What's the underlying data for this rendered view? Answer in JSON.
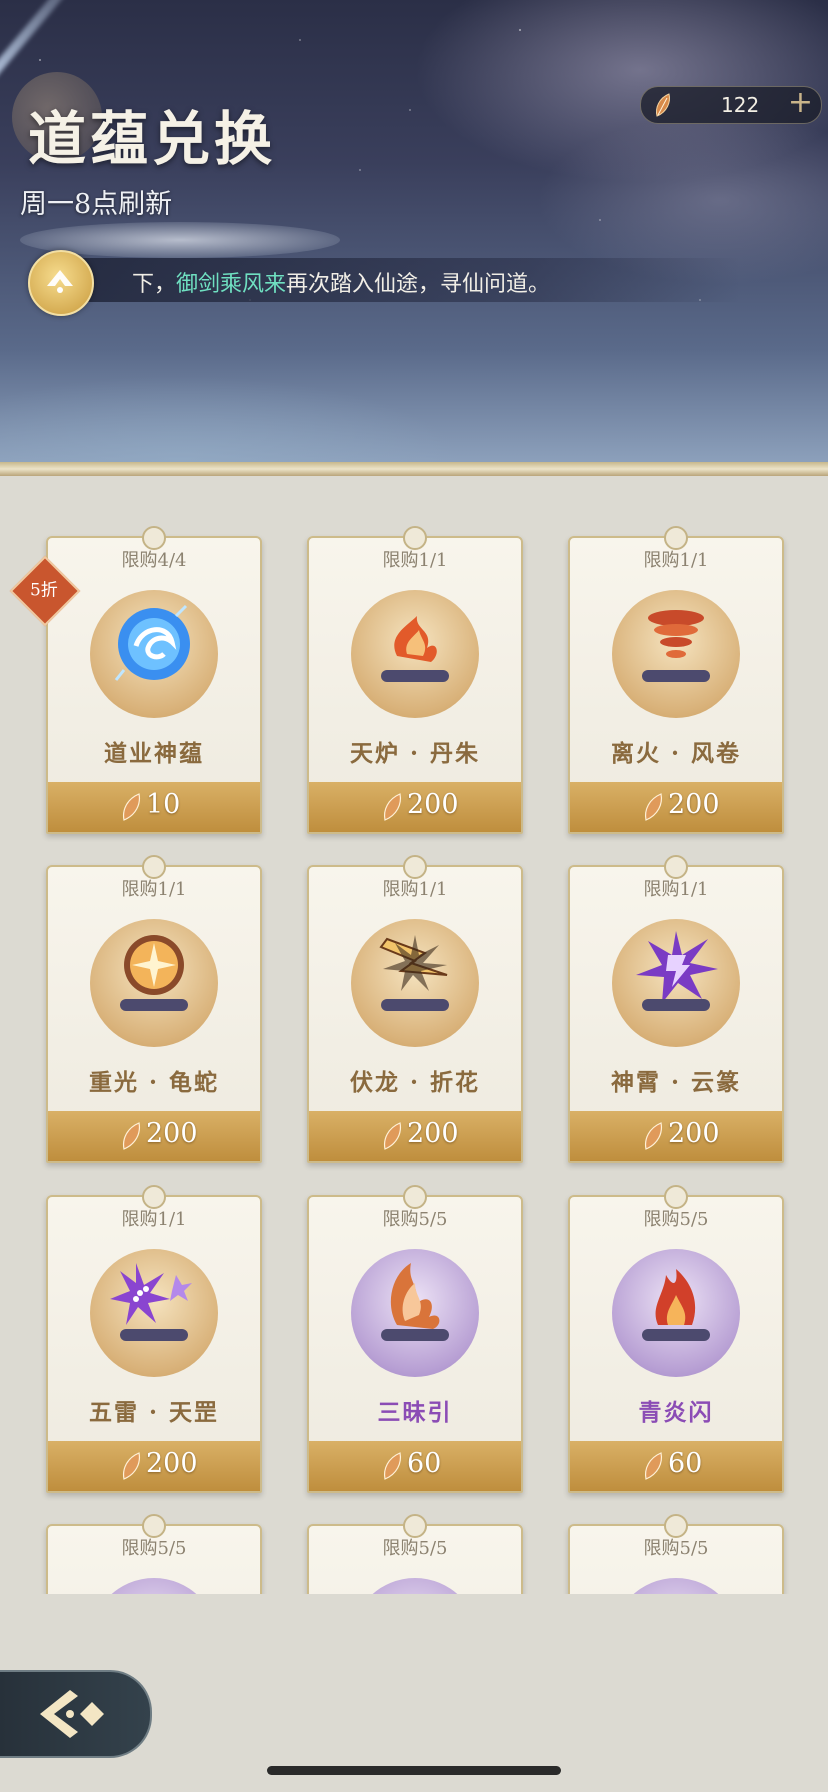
{
  "header": {
    "title": "道蕴兑换",
    "refresh_text": "周一8点刷新",
    "currency_amount": "122",
    "currency_plus": "+",
    "notice_before": "下，",
    "notice_highlight": "御剑乘风来",
    "notice_after": "再次踏入仙途，寻仙问道。"
  },
  "discount_badge": "5折",
  "items": [
    {
      "limit": "限购4/4",
      "name": "道业神蕴",
      "price": "10",
      "icon": "blue-orb-icon"
    },
    {
      "limit": "限购1/1",
      "name": "天炉 · 丹朱",
      "price": "200",
      "icon": "fire-scroll-icon"
    },
    {
      "limit": "限购1/1",
      "name": "离火 · 风卷",
      "price": "200",
      "icon": "tornado-scroll-icon"
    },
    {
      "limit": "限购1/1",
      "name": "重光 · 龟蛇",
      "price": "200",
      "icon": "light-burst-scroll-icon"
    },
    {
      "limit": "限购1/1",
      "name": "伏龙 · 折花",
      "price": "200",
      "icon": "lightning-scroll-icon"
    },
    {
      "limit": "限购1/1",
      "name": "神霄 · 云篆",
      "price": "200",
      "icon": "purple-thunder-scroll-icon"
    },
    {
      "limit": "限购1/1",
      "name": "五雷 · 天罡",
      "price": "200",
      "icon": "five-thunder-scroll-icon"
    },
    {
      "limit": "限购5/5",
      "name": "三昧引",
      "price": "60",
      "icon": "flame-claw-scroll-icon"
    },
    {
      "limit": "限购5/5",
      "name": "青炎闪",
      "price": "60",
      "icon": "flame-scroll-icon"
    },
    {
      "limit": "限购5/5",
      "name": "",
      "price": "",
      "icon": ""
    },
    {
      "limit": "限购5/5",
      "name": "",
      "price": "",
      "icon": ""
    },
    {
      "limit": "限购5/5",
      "name": "",
      "price": "",
      "icon": ""
    }
  ],
  "colors": {
    "accent_gold": "#bf8e3d",
    "highlight_green": "#6fe0c1",
    "purple_name": "#8b4cb5",
    "brown_name": "#8a6a3e"
  }
}
